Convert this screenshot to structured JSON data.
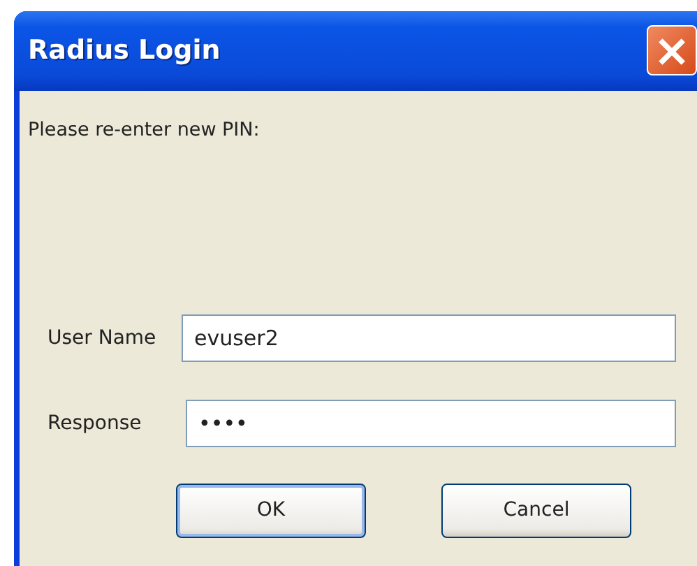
{
  "window": {
    "title": "Radius Login",
    "close": "×"
  },
  "prompt": "Please re-enter new PIN:",
  "fields": [
    {
      "label": "User Name",
      "value": "evuser2"
    },
    {
      "label": "Response",
      "value": "••••"
    }
  ],
  "buttons": [
    {
      "label": "OK",
      "default": true
    },
    {
      "label": "Cancel",
      "default": false
    }
  ]
}
